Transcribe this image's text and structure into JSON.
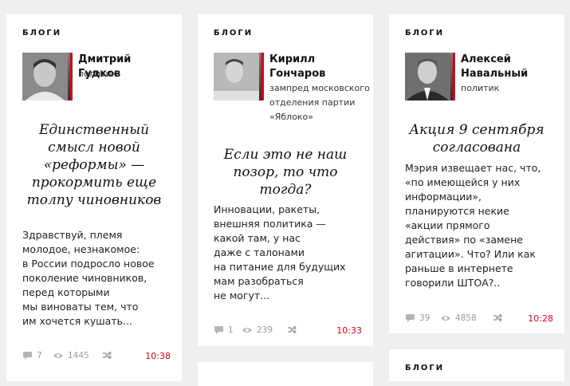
{
  "cards": [
    {
      "section": "БЛОГИ",
      "author": {
        "name": "Дмитрий Гудков",
        "role": "политик"
      },
      "headline": "Единственный смысл новой «реформы» — прокормить еще толпу чиновников",
      "lead": "Здравствуй, племя\nмолодое, незнакомое:\nв России подросло новое\nпоколение чиновников,\nперед которыми\nмы виноваты тем, что\nим хочется кушать...",
      "comments": "7",
      "views": "1445",
      "time": "10:38"
    },
    {
      "section": "БЛОГИ",
      "author": {
        "name": "Кирилл Гончаров",
        "role": "зампред московского отделения партии «Яблоко»"
      },
      "headline": "Если это не наш позор, то что тогда?",
      "lead": "Инновации, ракеты,\nвнешняя политика —\nкакой там, у нас\nдаже с талонами\nна питание для будущих\nмам разобраться\nне могут...",
      "comments": "1",
      "views": "239",
      "time": "10:33"
    },
    {
      "section": "БЛОГИ",
      "author": {
        "name": "Алексей Навальный",
        "role": "политик"
      },
      "headline": "Акция 9 сентября согласована",
      "lead": "Мэрия извещает нас, что,\n«по имеющейся у них\nинформации»,\nпланируются некие\n«акции прямого\nдействия» по «замене\nагитации». Что? Или как\nраньше в интернете\nговорили ШТОА?..",
      "comments": "39",
      "views": "4858",
      "time": "10:28"
    }
  ],
  "next_card": {
    "section": "БЛОГИ"
  },
  "icons": {
    "comments": "comment-icon",
    "views": "eye-icon",
    "share": "shuffle-share-icon"
  },
  "colors": {
    "accent": "#d0021b",
    "background": "#efefef",
    "card": "#ffffff",
    "meta": "#9a9a9a"
  }
}
